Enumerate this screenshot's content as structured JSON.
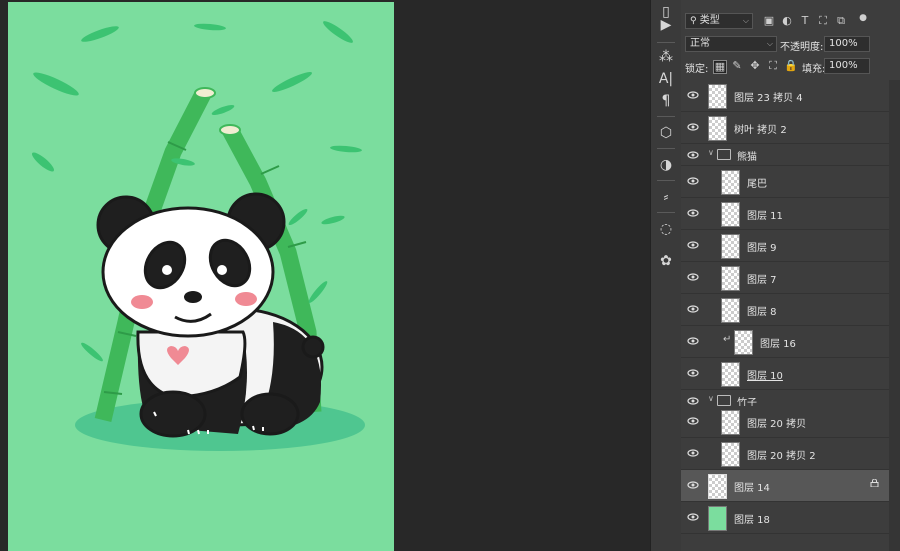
{
  "layers_panel": {
    "filter_kind": "类型",
    "blend_mode": "正常",
    "opacity_label": "不透明度:",
    "opacity_value": "100%",
    "lock_label": "锁定:",
    "fill_label": "填充:",
    "fill_value": "100%",
    "layers": [
      {
        "name": "图层 23 拷贝 4",
        "type": "layer",
        "indent": 0
      },
      {
        "name": "树叶 拷贝 2",
        "type": "layer",
        "indent": 0
      },
      {
        "name": "熊猫",
        "type": "group",
        "indent": 0
      },
      {
        "name": "尾巴",
        "type": "layer",
        "indent": 1
      },
      {
        "name": "图层 11",
        "type": "layer",
        "indent": 1
      },
      {
        "name": "图层 9",
        "type": "layer",
        "indent": 1
      },
      {
        "name": "图层 7",
        "type": "layer",
        "indent": 1
      },
      {
        "name": "图层 8",
        "type": "layer",
        "indent": 1
      },
      {
        "name": "图层 16",
        "type": "clipped",
        "indent": 1
      },
      {
        "name": "图层 10",
        "type": "layer",
        "indent": 1
      },
      {
        "name": "竹子",
        "type": "group",
        "indent": 0
      },
      {
        "name": "图层 20 拷贝",
        "type": "layer",
        "indent": 1
      },
      {
        "name": "图层 20 拷贝 2",
        "type": "layer",
        "indent": 1
      },
      {
        "name": "图层 14",
        "type": "layer",
        "indent": 0,
        "selected": true,
        "locked": true
      },
      {
        "name": "图层 18",
        "type": "fill",
        "indent": 0
      }
    ]
  },
  "colors": {
    "canvas_bg": "#7bdd9e",
    "panel_bg": "#3d3d3d",
    "selected_row": "#575757"
  },
  "icons": {
    "filter": "search-icon",
    "lock_transparent": "checkerboard-lock-icon",
    "lock_paint": "brush-icon",
    "lock_move": "move-icon",
    "lock_artboard": "artboard-icon",
    "lock_all": "lock-icon"
  }
}
